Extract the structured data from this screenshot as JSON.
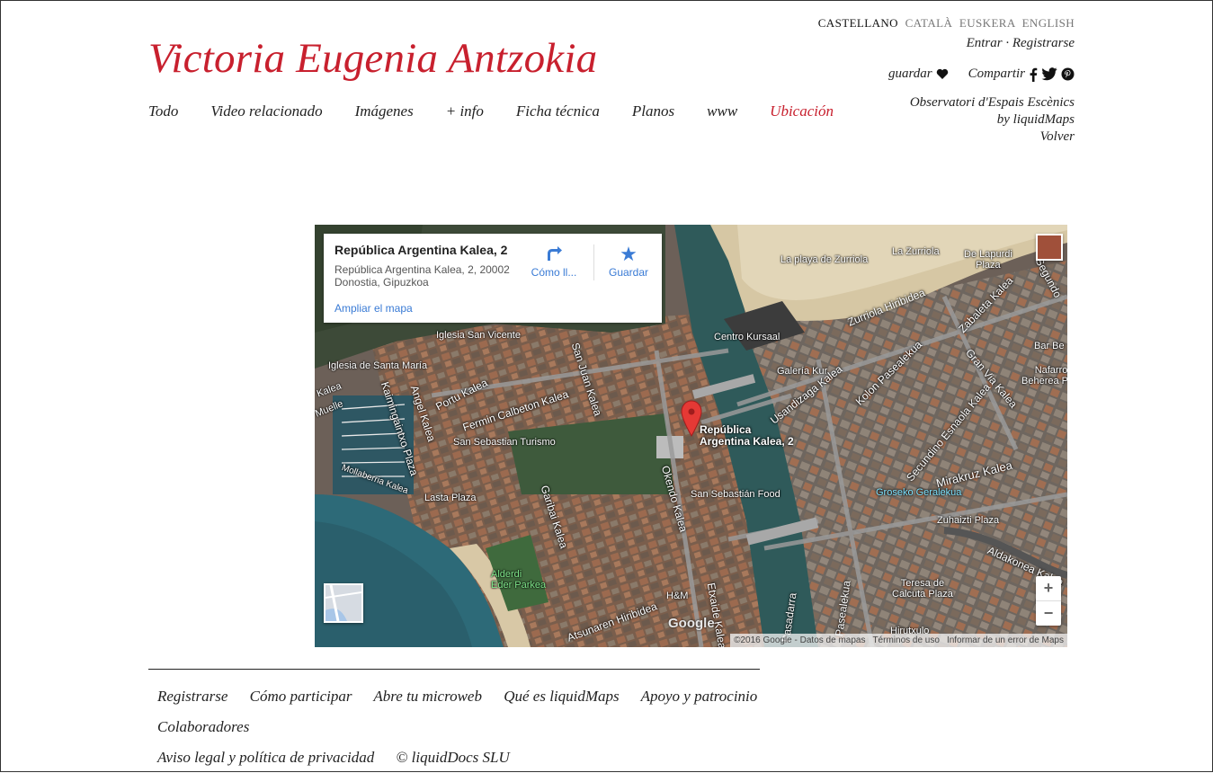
{
  "site": {
    "title": "Victoria Eugenia Antzokia"
  },
  "nav": {
    "items": [
      {
        "label": "Todo"
      },
      {
        "label": "Video relacionado"
      },
      {
        "label": "Imágenes"
      },
      {
        "label": "+ info"
      },
      {
        "label": "Ficha técnica"
      },
      {
        "label": "Planos"
      },
      {
        "label": "www"
      },
      {
        "label": "Ubicación",
        "active": true
      }
    ]
  },
  "languages": [
    {
      "label": "CASTELLANO",
      "active": true
    },
    {
      "label": "CATALÀ"
    },
    {
      "label": "EUSKERA"
    },
    {
      "label": "ENGLISH"
    }
  ],
  "auth": {
    "login": "Entrar",
    "separator": "·",
    "register": "Registrarse"
  },
  "share": {
    "save_label": "guardar",
    "share_label": "Compartir",
    "icons": [
      "heart-icon",
      "facebook-icon",
      "twitter-icon",
      "pinterest-icon"
    ]
  },
  "observatory": {
    "line1": "Observatori d'Espais Escènics",
    "line2": "by liquidMaps",
    "back": "Volver"
  },
  "map": {
    "card": {
      "title": "República Argentina Kalea, 2",
      "address_line1": "República Argentina Kalea, 2, 20002",
      "address_line2": "Donostia, Gipuzkoa",
      "enlarge": "Ampliar el mapa",
      "directions": "Cómo ll...",
      "save": "Guardar"
    },
    "pin_label_line1": "República",
    "pin_label_line2": "Argentina Kalea, 2",
    "places": {
      "playa": "La playa de Zurriola",
      "zurriola": "La Zurriola",
      "lapurdi1": "De Lapurdi",
      "lapurdi2": "Plaza",
      "iglesia_vicente": "Iglesia San Vicente",
      "iglesia_maria": "Iglesia de Santa María",
      "kursaal": "Centro Kursaal",
      "galeria": "Galería Kur",
      "turismo": "San Sebastian Turismo",
      "food": "San Sebastián Food",
      "lasta": "Lasta Plaza",
      "groseko": "Groseko Geralekua",
      "zuhaizti": "Zuhaizti Plaza",
      "teresa1": "Teresa de",
      "teresa2": "Calcuta Plaza",
      "hirutxulo": "Hirutxulo",
      "hm": "H&M",
      "alderdi1": "Alderdi",
      "alderdi2": "Eder Parkea",
      "barbe": "Bar Be",
      "nafarroa1": "Nafarroa",
      "nafarroa2": "Beherea Plaza",
      "muelle": "Muelle",
      "kalea": "Kalea"
    },
    "streets": {
      "portu": "Portu Kalea",
      "fermin": "Fermin Calbeton Kalea",
      "sanjuan": "San Juan Kalea",
      "angel": "Angel Kalea",
      "kaimingaintxo": "Kaimingaintxo Plaza",
      "mollaberria": "Mollaberria Kalea",
      "garibai": "Garibai Kalea",
      "okendo": "Okendo Kalea",
      "usandizaga": "Usandizaga Kalea",
      "kolon": "Kolon Pasealekua",
      "zurriola": "Zurriola Hiribidea",
      "zabaleta": "Zabaleta Kalea",
      "granvia": "Gran Via Kalea",
      "segundo": "Segundo Ezeandia Kalea",
      "secundino": "Secundino Esnaola Kalea",
      "mirakruz": "Mirakruz Kalea",
      "aldakonea": "Aldakonea Kalea",
      "pasealekua": "Pasealekua",
      "pasadarra": "Pasadarra",
      "etxaide": "Etxaide Kalea",
      "hiribidea": "Hiribidea",
      "atsunaren": "Atsunaren Hiribidea",
      "segundo_top": "Segundo"
    },
    "zoom_in": "+",
    "zoom_out": "−",
    "google_logo": "Google",
    "attribution": {
      "copyright": "©2016 Google - Datos de mapas",
      "terms": "Términos de uso",
      "report": "Informar de un error de Maps"
    },
    "colors": {
      "sea": "#2d6a78",
      "sand": "#d8c8a6",
      "city": "#6b5d52",
      "pin": "#e53935"
    }
  },
  "footer": {
    "links": [
      {
        "label": "Registrarse"
      },
      {
        "label": "Cómo participar"
      },
      {
        "label": "Abre tu microweb"
      },
      {
        "label": "Qué es liquidMaps"
      },
      {
        "label": "Apoyo y patrocinio"
      },
      {
        "label": "Colaboradores"
      },
      {
        "label": "Aviso legal y política de privacidad"
      },
      {
        "label": "© liquidDocs SLU"
      }
    ]
  },
  "accent_color": "#c8202e"
}
